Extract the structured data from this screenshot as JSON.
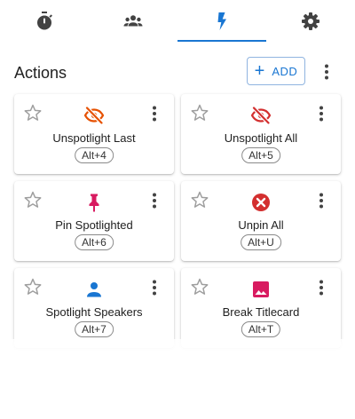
{
  "colors": {
    "accent": "#1976d2",
    "tab_icon": "#424242",
    "orange": "#e65100",
    "red": "#d32f2f",
    "pink": "#d81b60",
    "blue": "#1976d2",
    "star": "#9e9e9e"
  },
  "tabs": [
    {
      "icon": "stopwatch-icon",
      "active": false
    },
    {
      "icon": "group-icon",
      "active": false
    },
    {
      "icon": "lightning-bolt-icon",
      "active": true
    },
    {
      "icon": "gear-icon",
      "active": false
    }
  ],
  "header": {
    "title": "Actions",
    "add_label": "ADD",
    "add_icon": "plus-icon",
    "more_icon": "more-vertical-icon"
  },
  "actions": [
    {
      "label": "Unspotlight Last",
      "hotkey": "Alt+4",
      "icon": "eye-off-icon",
      "icon_color": "#e65100",
      "favorite": false
    },
    {
      "label": "Unspotlight All",
      "hotkey": "Alt+5",
      "icon": "eye-off-icon",
      "icon_color": "#d32f2f",
      "favorite": false
    },
    {
      "label": "Pin Spotlighted",
      "hotkey": "Alt+6",
      "icon": "pushpin-icon",
      "icon_color": "#d81b60",
      "favorite": false
    },
    {
      "label": "Unpin All",
      "hotkey": "Alt+U",
      "icon": "cancel-circle-icon",
      "icon_color": "#d32f2f",
      "favorite": false
    },
    {
      "label": "Spotlight Speakers",
      "hotkey": "Alt+7",
      "icon": "person-icon",
      "icon_color": "#1976d2",
      "favorite": false
    },
    {
      "label": "Break Titlecard",
      "hotkey": "Alt+T",
      "icon": "image-icon",
      "icon_color": "#d81b60",
      "favorite": false
    }
  ]
}
